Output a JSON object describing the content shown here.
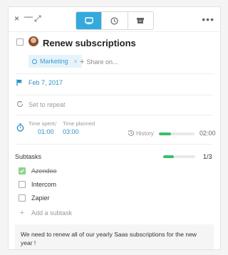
{
  "window": {
    "close_glyph": "×",
    "minimize_glyph": "—",
    "expand_glyph": "⤢",
    "more_glyph": "•••"
  },
  "tabs": [
    {
      "icon": "card-icon",
      "active": true
    },
    {
      "icon": "clock-icon",
      "active": false
    },
    {
      "icon": "archive-icon",
      "active": false
    }
  ],
  "task": {
    "title": "Renew subscriptions",
    "tag": "Marketing",
    "tag_remove": "×",
    "share_label": "Share on...",
    "share_glyph": "+"
  },
  "due_date": "Feb 7, 2017",
  "repeat_label": "Set to repeat",
  "time": {
    "spent_label": "Time spent",
    "spent_value": "01:00",
    "planned_label": "Time planned",
    "planned_value": "03:00",
    "separator": "/",
    "history_label": "History",
    "progress_fraction": 0.33,
    "total": "02:00"
  },
  "subtasks": {
    "header": "Subtasks",
    "progress_fraction": 0.33,
    "count": "1/3",
    "items": [
      {
        "label": "Azendoo",
        "done": true
      },
      {
        "label": "Intercom",
        "done": false
      },
      {
        "label": "Zapier",
        "done": false
      }
    ],
    "add_label": "Add a subtask",
    "add_glyph": "+"
  },
  "note": "We need to renew all of our yearly Saas subscriptions for the new year !",
  "colors": {
    "accent": "#33a9dd",
    "progress": "#3bbf6a",
    "tag_bg": "#e6f3fa"
  }
}
